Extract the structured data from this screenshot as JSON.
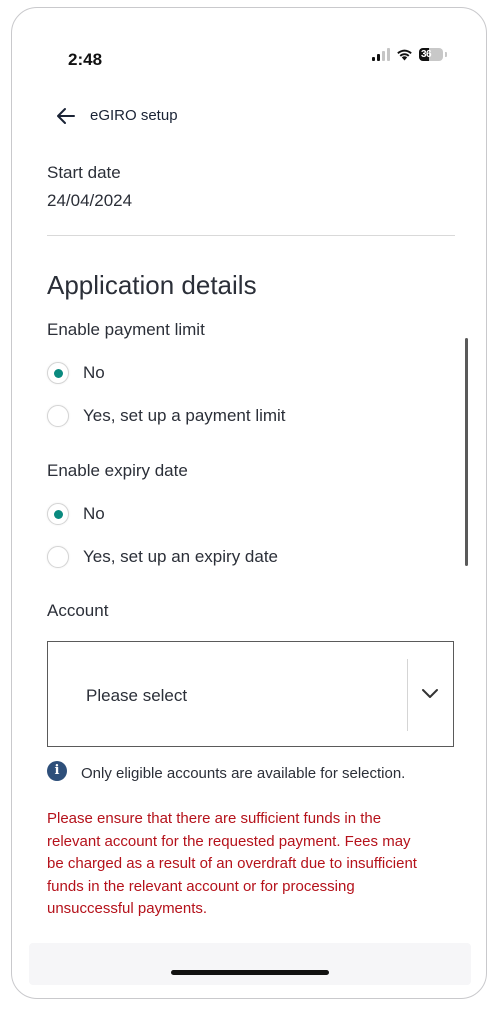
{
  "status_bar": {
    "time": "2:48",
    "battery": "36"
  },
  "header": {
    "title": "eGIRO setup",
    "back_icon": "arrow-left-icon"
  },
  "start_date": {
    "label": "Start date",
    "value": "24/04/2024"
  },
  "application_details": {
    "title": "Application details",
    "payment_limit": {
      "label": "Enable payment limit",
      "options": [
        {
          "label": "No",
          "selected": true
        },
        {
          "label": "Yes, set up a payment limit",
          "selected": false
        }
      ]
    },
    "expiry_date": {
      "label": "Enable expiry date",
      "options": [
        {
          "label": "No",
          "selected": true
        },
        {
          "label": "Yes, set up an expiry date",
          "selected": false
        }
      ]
    },
    "account": {
      "label": "Account",
      "selected_value": "Please select",
      "icon": "chevron-down-icon"
    },
    "info": {
      "icon": "info-icon",
      "text": "Only eligible accounts are available for selection."
    },
    "warning": "Please ensure that there are sufficient funds in the relevant account for the requested payment. Fees may be charged as a result of an overdraft due to insufficient funds in the relevant account or for processing unsuccessful payments."
  },
  "colors": {
    "accent": "#0a8a7f",
    "warning": "#b5121b",
    "info_icon": "#2e4f7a"
  }
}
